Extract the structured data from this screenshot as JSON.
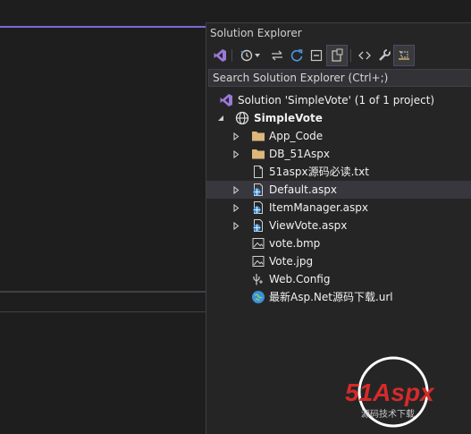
{
  "panel": {
    "title": "Solution Explorer",
    "search_placeholder": "Search Solution Explorer (Ctrl+;)"
  },
  "colors": {
    "accent": "#7a69d8",
    "folder": "#dcb67a",
    "globe": "#3c8fd8"
  },
  "toolbar": {
    "icons": [
      "vs-solution-icon",
      "history-icon",
      "dropdown-arrow-icon",
      "sync-icon",
      "refresh-icon",
      "collapse-all-icon",
      "show-all-files-icon",
      "code-view-icon",
      "properties-icon",
      "preview-icon"
    ]
  },
  "tree": {
    "solution": "Solution 'SimpleVote' (1 of 1 project)",
    "project": "SimpleVote",
    "items": [
      {
        "label": "App_Code",
        "icon": "folder-icon",
        "expandable": true
      },
      {
        "label": "DB_51Aspx",
        "icon": "folder-icon",
        "expandable": true
      },
      {
        "label": "51aspx源码必读.txt",
        "icon": "text-file-icon",
        "expandable": false
      },
      {
        "label": "Default.aspx",
        "icon": "web-page-icon",
        "expandable": true,
        "selected": true
      },
      {
        "label": "ItemManager.aspx",
        "icon": "web-page-icon",
        "expandable": true
      },
      {
        "label": "ViewVote.aspx",
        "icon": "web-page-icon",
        "expandable": true
      },
      {
        "label": "vote.bmp",
        "icon": "image-file-icon",
        "expandable": false
      },
      {
        "label": "Vote.jpg",
        "icon": "image-file-icon",
        "expandable": false
      },
      {
        "label": "Web.Config",
        "icon": "config-file-icon",
        "expandable": false
      },
      {
        "label": "最新Asp.Net源码下载.url",
        "icon": "web-link-icon",
        "expandable": false
      }
    ]
  },
  "watermark": {
    "logo_text": "51Aspx",
    "sub_text": "源码技术下载"
  }
}
